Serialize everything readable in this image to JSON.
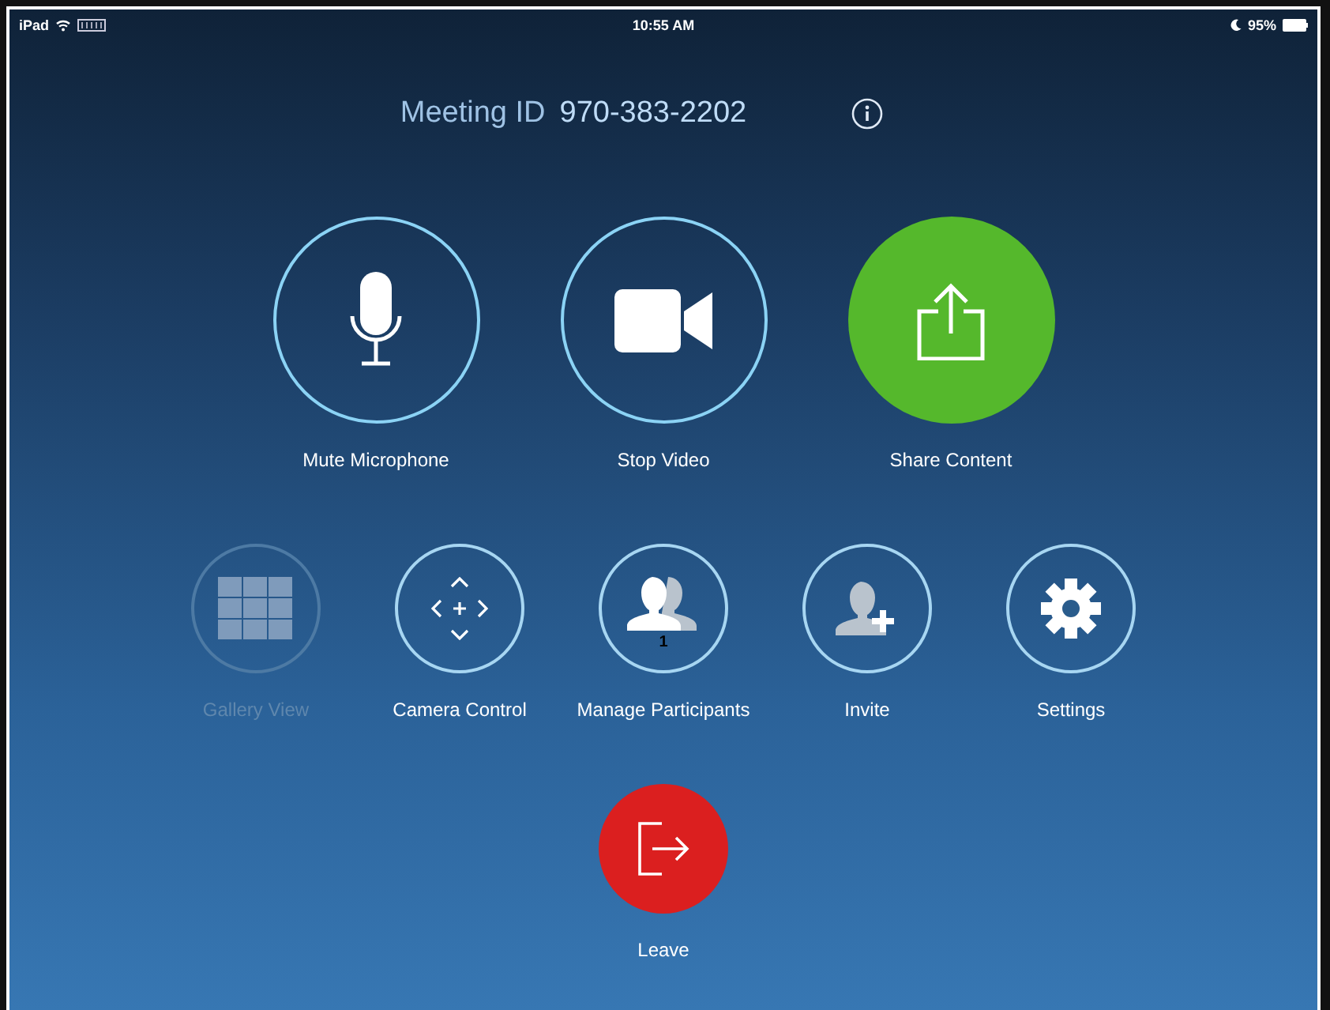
{
  "status_bar": {
    "device": "iPad",
    "time": "10:55 AM",
    "battery": "95%"
  },
  "meeting": {
    "label": "Meeting ID",
    "id": "970-383-2202"
  },
  "primary_actions": [
    {
      "label": "Mute Microphone",
      "kind": "microphone"
    },
    {
      "label": "Stop Video",
      "kind": "video"
    },
    {
      "label": "Share Content",
      "kind": "share"
    }
  ],
  "secondary_actions": [
    {
      "label": "Gallery View",
      "kind": "gallery",
      "disabled": true
    },
    {
      "label": "Camera Control",
      "kind": "camera",
      "disabled": false
    },
    {
      "label": "Manage Participants",
      "kind": "participants",
      "disabled": false,
      "badge": "1"
    },
    {
      "label": "Invite",
      "kind": "invite",
      "disabled": false
    },
    {
      "label": "Settings",
      "kind": "settings",
      "disabled": false
    }
  ],
  "leave": {
    "label": "Leave"
  }
}
